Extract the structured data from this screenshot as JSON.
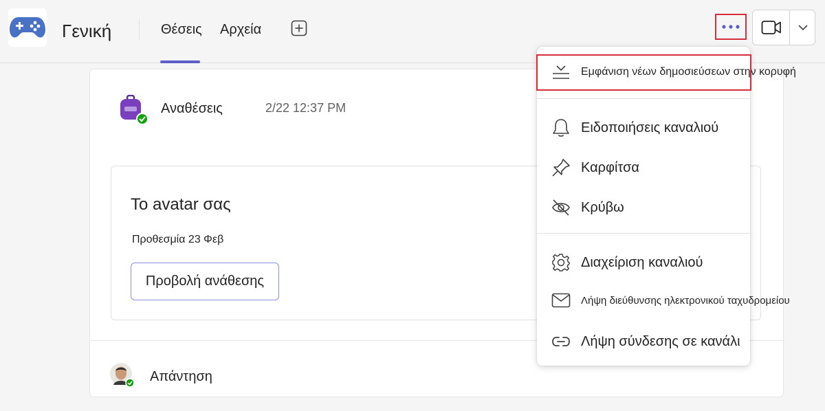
{
  "header": {
    "channel_title": "Γενική",
    "tabs": [
      {
        "label": "Θέσεις",
        "active": true
      },
      {
        "label": "Αρχεία",
        "active": false
      }
    ],
    "add_tab_icon": "add-square-icon",
    "more_icon": "more-horizontal-icon",
    "video_icon": "video-camera-icon",
    "chevron_icon": "chevron-down-icon",
    "accent_color": "#5b5fc7"
  },
  "post": {
    "app_name": "Αναθέσεις",
    "timestamp": "2/22 12:37 PM",
    "card": {
      "title": "Το avatar σας",
      "due": "Προθεσμία 23 Φεβ",
      "button_label": "Προβολή ανάθεσης"
    },
    "reply_label": "Απάντηση"
  },
  "menu": {
    "items": [
      {
        "label": "Εμφάνιση νέων δημοσιεύσεων στην κορυφή",
        "icon": "sort-top-icon",
        "highlighted": true
      },
      {
        "label": "Ειδοποιήσεις καναλιού",
        "icon": "bell-icon"
      },
      {
        "label": "Καρφίτσα",
        "icon": "pin-icon"
      },
      {
        "label": "Κρύβω",
        "icon": "eye-off-icon"
      },
      {
        "label": "Διαχείριση καναλιού",
        "icon": "gear-icon"
      },
      {
        "label": "Λήψη διεύθυνσης ηλεκτρονικού ταχυδρομείου",
        "icon": "mail-icon"
      },
      {
        "label": "Λήψη σύνδεσης σε κανάλι",
        "icon": "link-icon"
      }
    ]
  }
}
